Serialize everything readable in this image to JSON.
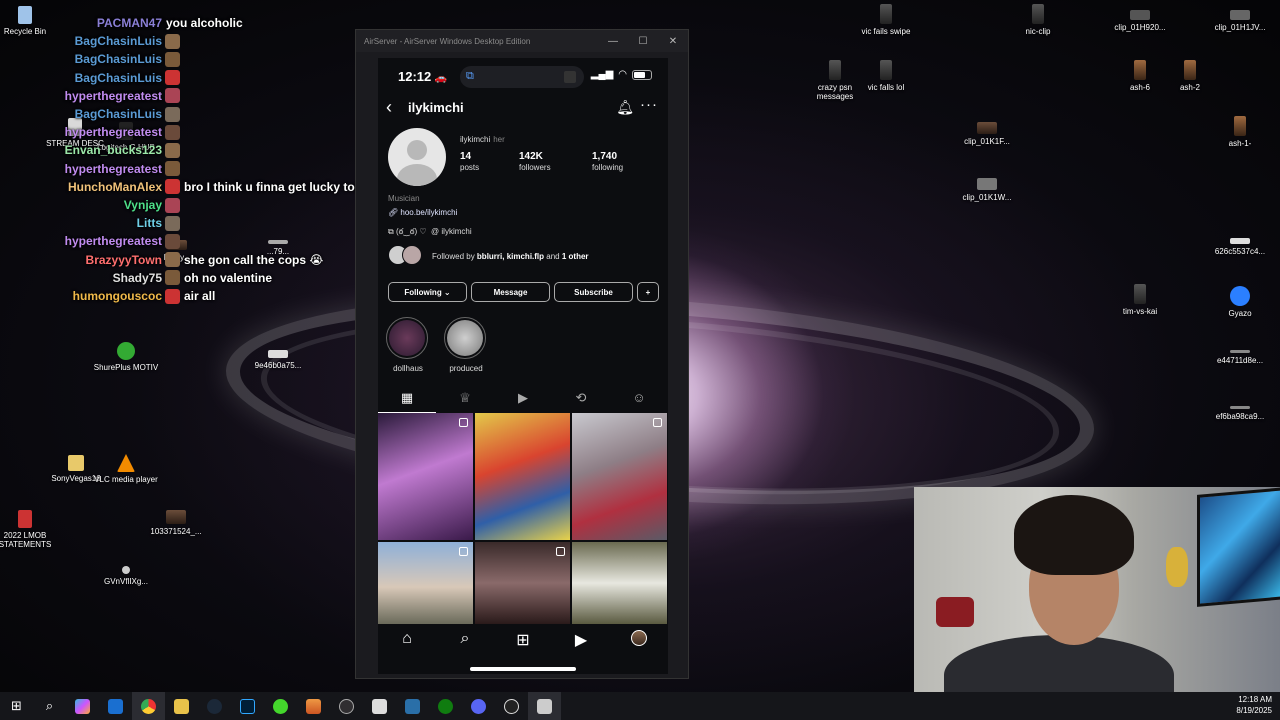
{
  "desktop": {
    "icons": [
      {
        "label": "Recycle Bin"
      },
      {
        "label": "STREAM DESC"
      },
      {
        "label": "Logitech G HUB"
      },
      {
        "label": "ShurePlus MOTIV"
      },
      {
        "label": "SonyVegas16"
      },
      {
        "label": "VLC media player"
      },
      {
        "label": "2022 LMOB STATEMENTS"
      },
      {
        "label": "103371524_..."
      },
      {
        "label": "GVnVflIXg..."
      },
      {
        "label": "9e46b0a75..."
      },
      {
        "label": "Brazy..."
      },
      {
        "label": "...79..."
      },
      {
        "label": "vic fails swipe"
      },
      {
        "label": "crazy psn messages"
      },
      {
        "label": "vic falls lol"
      },
      {
        "label": "nic-clip"
      },
      {
        "label": "clip_01H920..."
      },
      {
        "label": "clip_01H1JV..."
      },
      {
        "label": "ash-6"
      },
      {
        "label": "ash-2"
      },
      {
        "label": "clip_01K1F..."
      },
      {
        "label": "ash-1-"
      },
      {
        "label": "clip_01K1W..."
      },
      {
        "label": "626c5537c4..."
      },
      {
        "label": "tim-vs-kai"
      },
      {
        "label": "Gyazo"
      },
      {
        "label": "e44711d8e..."
      },
      {
        "label": "ef6ba98ca9..."
      }
    ]
  },
  "chat": {
    "messages": [
      {
        "user": "PACMAN47",
        "color": "#8a7fd6",
        "text": "you alcoholic"
      },
      {
        "user": "BagChasinLuis",
        "color": "#5b9bd5",
        "text": ""
      },
      {
        "user": "BagChasinLuis",
        "color": "#5b9bd5",
        "text": ""
      },
      {
        "user": "BagChasinLuis",
        "color": "#5b9bd5",
        "text": ""
      },
      {
        "user": "hyperthegreatest",
        "color": "#c18cf0",
        "text": ""
      },
      {
        "user": "BagChasinLuis",
        "color": "#5b9bd5",
        "text": ""
      },
      {
        "user": "hyperthegreatest",
        "color": "#c18cf0",
        "text": ""
      },
      {
        "user": "Envan_bucks123",
        "color": "#9be6a8",
        "text": ""
      },
      {
        "user": "hyperthegreatest",
        "color": "#c18cf0",
        "text": ""
      },
      {
        "user": "HunchoManAlex",
        "color": "#f0c27a",
        "text": "bro I think u finna get lucky tonight"
      },
      {
        "user": "Vynjay",
        "color": "#4ee08a",
        "text": ""
      },
      {
        "user": "Litts",
        "color": "#6fd0e8",
        "text": ""
      },
      {
        "user": "hyperthegreatest",
        "color": "#c18cf0",
        "text": ""
      },
      {
        "user": "BrazyyyTown",
        "color": "#ff6f6f",
        "text": "she gon call the cops 😭"
      },
      {
        "user": "Shady75",
        "color": "#e0e0e0",
        "text": "oh no valentine"
      },
      {
        "user": "humongouscoc",
        "color": "#f0b94a",
        "text": "air all"
      }
    ]
  },
  "airserver": {
    "title": "AirServer - AirServer Windows Desktop Edition",
    "controls": {
      "minimize": "—",
      "maximize": "☐",
      "close": "✕"
    }
  },
  "phone": {
    "status": {
      "time": "12:12",
      "car": "🚗"
    },
    "profile": {
      "username": "ilykimchi",
      "full_name": "ilykimchi",
      "pronoun": "her",
      "posts": "14",
      "posts_label": "posts",
      "followers": "142K",
      "followers_label": "followers",
      "following": "1,740",
      "following_label": "following",
      "category": "Musician",
      "link": "hoo.be/ilykimchi",
      "threads_prefix": "(ఠ‿ఠ) ♡",
      "threads_handle": "ilykimchi",
      "followed_by_prefix": "Followed by ",
      "followed_by_names": "bblurri, kimchi.flp",
      "followed_by_and": " and ",
      "followed_by_other": "1 other"
    },
    "buttons": {
      "following": "Following ⌄",
      "message": "Message",
      "subscribe": "Subscribe",
      "add_user": "+"
    },
    "highlights": [
      {
        "label": "dollhaus",
        "color": "#3a2a3f"
      },
      {
        "label": "produced",
        "color": "#9a9a9a"
      }
    ],
    "grid_colors": [
      "#8a5aa8",
      "#c9a83a",
      "#8e8e96",
      "#6f8fb8",
      "#4a3a3a",
      "#d8d8d0"
    ]
  },
  "colors": {
    "accent_blue": "#5aa0ff",
    "ig_background": "#0c0d10"
  },
  "taskbar": {
    "time": "12:18 AM",
    "date": "8/19/2025"
  }
}
